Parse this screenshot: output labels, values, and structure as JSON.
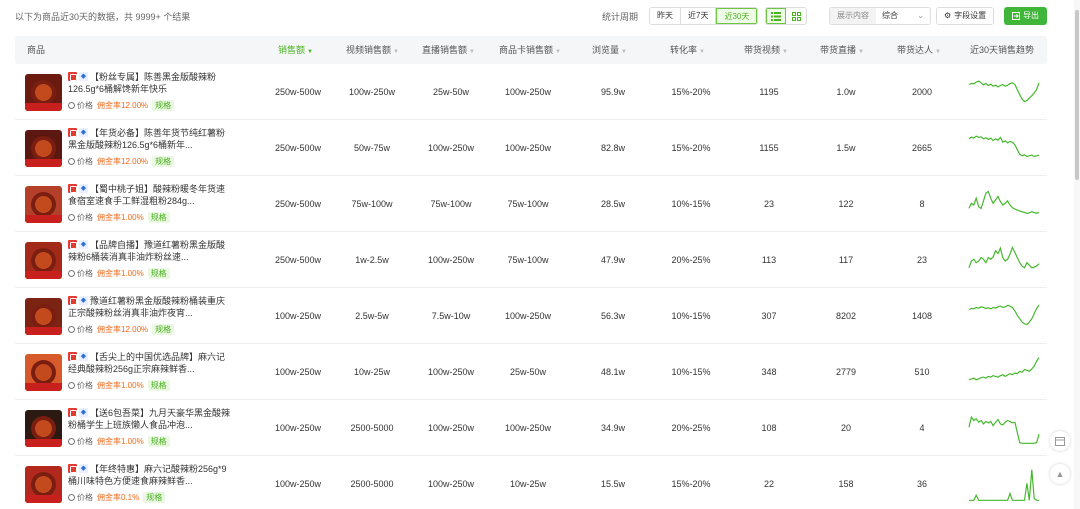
{
  "summary": "以下为商品近30天的数据，共 9999+ 个结果",
  "period": {
    "label": "统计周期",
    "options": [
      "昨天",
      "近7天",
      "近30天"
    ],
    "selected": "近30天"
  },
  "view": {
    "list_icon": "list-icon",
    "grid_icon": "grid-icon",
    "selected": "list"
  },
  "show_content": {
    "label": "展示内容",
    "value": "综合"
  },
  "field_settings": {
    "label": "字段设置",
    "icon": "gear-icon"
  },
  "export": {
    "label": "导出",
    "icon": "export-icon"
  },
  "columns": [
    "商品",
    "销售额",
    "视频销售额",
    "直播销售额",
    "商品卡销售额",
    "浏览量",
    "转化率",
    "带货视频",
    "带货直播",
    "带货达人",
    "近30天销售趋势"
  ],
  "sorted_column": "销售额",
  "accent_color": "#4cb320",
  "rows": [
    {
      "title": "【粉丝专属】陈善黑金版酸辣粉126.5g*6桶解馋新年快乐",
      "price_label": "价格",
      "commission": "佣金率12.00%",
      "tag": "规格",
      "sales": "250w-500w",
      "video_sales": "100w-250w",
      "live_sales": "25w-50w",
      "card_sales": "100w-250w",
      "views": "95.9w",
      "conversion": "15%-20%",
      "videos": "1195",
      "lives": "1.0w",
      "creators": "2000",
      "trend": [
        0.75,
        0.78,
        0.77,
        0.82,
        0.85,
        0.8,
        0.74,
        0.78,
        0.72,
        0.76,
        0.7,
        0.73,
        0.68,
        0.72,
        0.75,
        0.7,
        0.73,
        0.78,
        0.8,
        0.75,
        0.6,
        0.45,
        0.32,
        0.25,
        0.28,
        0.35,
        0.42,
        0.5,
        0.6,
        0.8
      ]
    },
    {
      "title": "【年货必备】陈善年货节纯红薯粉黑金版酸辣粉126.5g*6桶新年...",
      "price_label": "价格",
      "commission": "佣金率12.00%",
      "tag": "规格",
      "sales": "250w-500w",
      "video_sales": "50w-75w",
      "live_sales": "100w-250w",
      "card_sales": "100w-250w",
      "views": "82.8w",
      "conversion": "15%-20%",
      "videos": "1155",
      "lives": "1.5w",
      "creators": "2665",
      "trend": [
        0.8,
        0.85,
        0.82,
        0.88,
        0.84,
        0.86,
        0.8,
        0.83,
        0.78,
        0.82,
        0.75,
        0.8,
        0.76,
        0.84,
        0.7,
        0.74,
        0.68,
        0.72,
        0.7,
        0.62,
        0.48,
        0.35,
        0.3,
        0.33,
        0.28,
        0.3,
        0.32,
        0.28,
        0.3,
        0.32
      ]
    },
    {
      "title": "【蜀中桃子姐】酸辣粉暖冬年货速食宿室速食手工鲜湿粗粉284g...",
      "price_label": "价格",
      "commission": "佣金率1.00%",
      "tag": "规格",
      "sales": "250w-500w",
      "video_sales": "75w-100w",
      "live_sales": "75w-100w",
      "card_sales": "75w-100w",
      "views": "28.5w",
      "conversion": "10%-15%",
      "videos": "23",
      "lives": "122",
      "creators": "8",
      "trend": [
        0.4,
        0.55,
        0.5,
        0.7,
        0.45,
        0.4,
        0.62,
        0.85,
        0.9,
        0.7,
        0.55,
        0.65,
        0.75,
        0.6,
        0.5,
        0.55,
        0.62,
        0.5,
        0.42,
        0.38,
        0.35,
        0.32,
        0.3,
        0.28,
        0.25,
        0.27,
        0.3,
        0.28,
        0.26,
        0.28
      ]
    },
    {
      "title": "【品牌自播】豫道红薯粉黑金版酸辣粉6桶装消真非油炸粉丝速...",
      "price_label": "价格",
      "commission": "佣金率1.00%",
      "tag": "规格",
      "sales": "250w-500w",
      "video_sales": "1w-2.5w",
      "live_sales": "100w-250w",
      "card_sales": "75w-100w",
      "views": "47.9w",
      "conversion": "20%-25%",
      "videos": "113",
      "lives": "117",
      "creators": "23",
      "trend": [
        0.3,
        0.5,
        0.55,
        0.45,
        0.5,
        0.6,
        0.55,
        0.45,
        0.6,
        0.55,
        0.62,
        0.8,
        0.72,
        0.88,
        0.6,
        0.5,
        0.55,
        0.7,
        0.9,
        0.75,
        0.6,
        0.45,
        0.35,
        0.3,
        0.45,
        0.38,
        0.3,
        0.32,
        0.35,
        0.42
      ]
    },
    {
      "title": "豫道红薯粉黑金版酸辣粉桶装重庆正宗酸辣粉丝消真非油炸夜宵...",
      "price_label": "价格",
      "commission": "佣金率12.00%",
      "tag": "规格",
      "sales": "100w-250w",
      "video_sales": "2.5w-5w",
      "live_sales": "7.5w-10w",
      "card_sales": "100w-250w",
      "views": "56.3w",
      "conversion": "10%-15%",
      "videos": "307",
      "lives": "8202",
      "creators": "1408",
      "trend": [
        0.72,
        0.75,
        0.74,
        0.78,
        0.76,
        0.8,
        0.78,
        0.75,
        0.77,
        0.74,
        0.78,
        0.76,
        0.8,
        0.82,
        0.78,
        0.8,
        0.84,
        0.82,
        0.78,
        0.68,
        0.55,
        0.45,
        0.35,
        0.3,
        0.28,
        0.35,
        0.45,
        0.6,
        0.75,
        0.85
      ]
    },
    {
      "title": "【舌尖上的中国优选品牌】麻六记经典酸辣粉256g正宗麻辣鲜香...",
      "price_label": "价格",
      "commission": "佣金率1.00%",
      "tag": "规格",
      "sales": "100w-250w",
      "video_sales": "10w-25w",
      "live_sales": "100w-250w",
      "card_sales": "25w-50w",
      "views": "48.1w",
      "conversion": "10%-15%",
      "videos": "348",
      "lives": "2779",
      "creators": "510",
      "trend": [
        0.3,
        0.32,
        0.35,
        0.3,
        0.33,
        0.36,
        0.38,
        0.35,
        0.4,
        0.38,
        0.42,
        0.4,
        0.38,
        0.42,
        0.45,
        0.4,
        0.44,
        0.48,
        0.45,
        0.5,
        0.48,
        0.55,
        0.52,
        0.6,
        0.58,
        0.55,
        0.62,
        0.7,
        0.85,
        0.95
      ]
    },
    {
      "title": "【送6包吾菜】九月天豪华黑金酸辣粉桶学生上班族懒人食品冲泡...",
      "price_label": "价格",
      "commission": "佣金率1.00%",
      "tag": "规格",
      "sales": "100w-250w",
      "video_sales": "2500-5000",
      "live_sales": "100w-250w",
      "card_sales": "100w-250w",
      "views": "34.9w",
      "conversion": "20%-25%",
      "videos": "108",
      "lives": "20",
      "creators": "4",
      "trend": [
        0.55,
        0.85,
        0.75,
        0.8,
        0.7,
        0.75,
        0.65,
        0.72,
        0.68,
        0.72,
        0.6,
        0.7,
        0.78,
        0.65,
        0.62,
        0.7,
        0.75,
        0.72,
        0.68,
        0.7,
        0.4,
        0.1,
        0.08,
        0.08,
        0.08,
        0.08,
        0.08,
        0.08,
        0.1,
        0.35
      ]
    },
    {
      "title": "【年终特惠】麻六记酸辣粉256g*9桶川味特色方便速食麻辣鲜香...",
      "price_label": "价格",
      "commission": "佣金率0.1%",
      "tag": "规格",
      "sales": "100w-250w",
      "video_sales": "2500-5000",
      "live_sales": "100w-250w",
      "card_sales": "10w-25w",
      "views": "15.5w",
      "conversion": "15%-20%",
      "videos": "22",
      "lives": "158",
      "creators": "36",
      "trend": [
        0.05,
        0.05,
        0.05,
        0.2,
        0.05,
        0.05,
        0.05,
        0.05,
        0.05,
        0.05,
        0.05,
        0.05,
        0.05,
        0.05,
        0.05,
        0.05,
        0.05,
        0.25,
        0.05,
        0.05,
        0.05,
        0.05,
        0.05,
        0.05,
        0.55,
        0.05,
        0.95,
        0.1,
        0.05,
        0.05
      ]
    }
  ],
  "float_buttons": [
    "calendar-icon",
    "back-to-top-icon"
  ]
}
